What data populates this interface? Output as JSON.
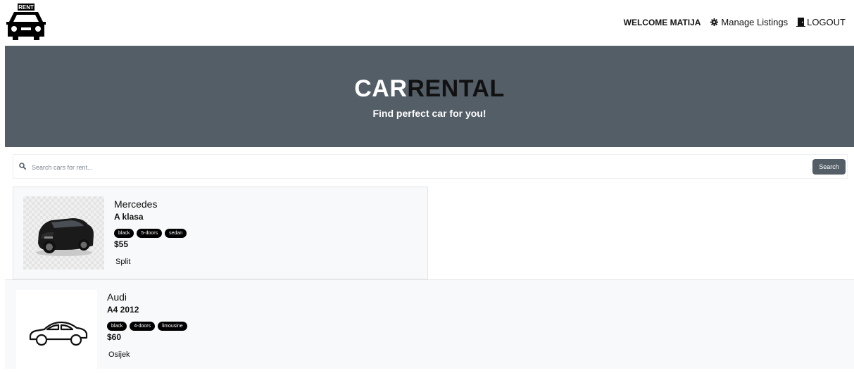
{
  "brand": {
    "logo_text": "RENT"
  },
  "nav": {
    "welcome": "WELCOME MATIJA",
    "manage_label": "Manage Listings",
    "logout_label": "LOGOUT"
  },
  "hero": {
    "title_part1": "CAR",
    "title_part2": "RENTAL",
    "subtitle": "Find perfect car for you!"
  },
  "search": {
    "placeholder": "Search cars for rent...",
    "button_label": "Search"
  },
  "listings": [
    {
      "make": "Mercedes",
      "model": "A klasa",
      "tags": [
        "black",
        "5-doors",
        "sedan"
      ],
      "price": "$55",
      "city": "Split"
    },
    {
      "make": "Audi",
      "model": "A4 2012",
      "tags": [
        "black",
        "4-doors",
        "limousine"
      ],
      "price": "$60",
      "city": "Osijek"
    }
  ],
  "colors": {
    "hero_bg": "#545e67",
    "button_bg": "#545e67",
    "tag_bg": "#000000",
    "card_bg": "#f8f9fa"
  }
}
